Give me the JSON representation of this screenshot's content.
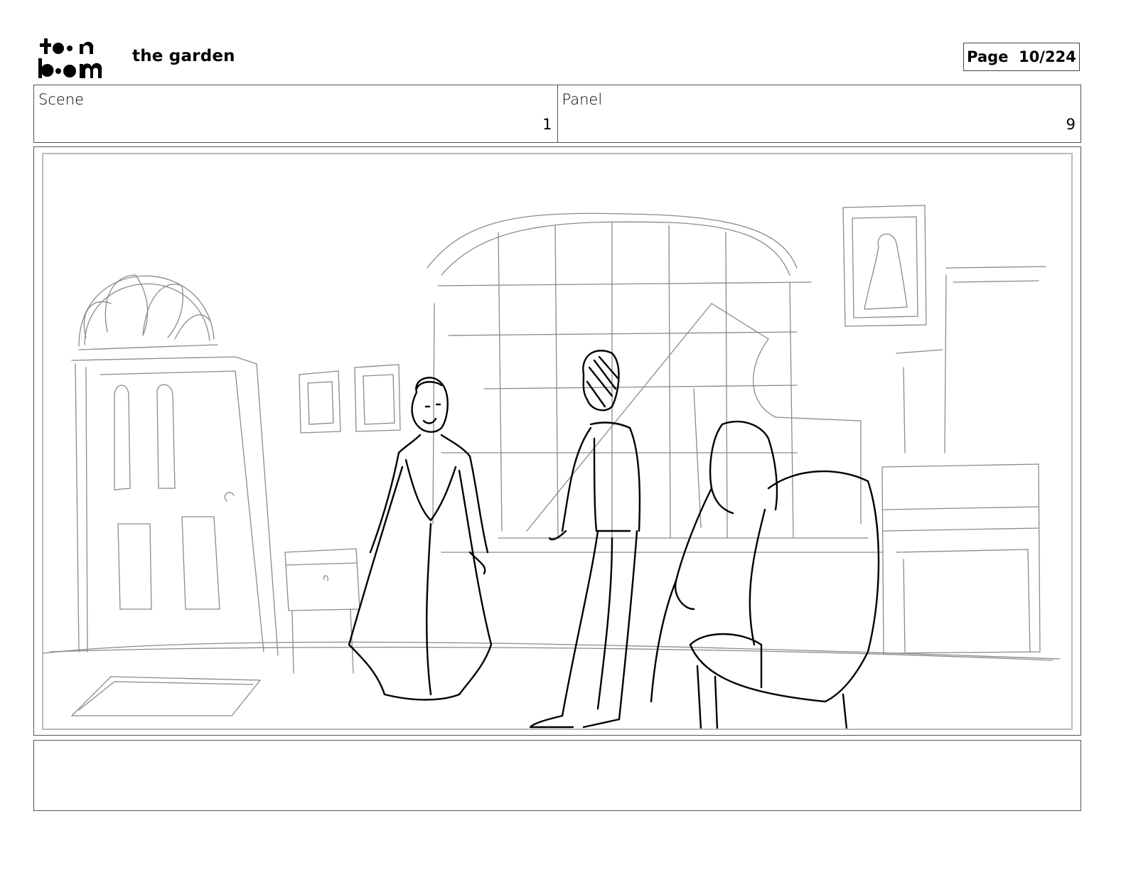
{
  "header": {
    "logo_text_top": "toon",
    "logo_text_bottom": "boom",
    "project_title": "the garden",
    "page_label": "Page",
    "page_number": "10/224"
  },
  "scene": {
    "label": "Scene",
    "value": "1"
  },
  "panel": {
    "label": "Panel",
    "value": "9"
  },
  "notes": {
    "text": ""
  },
  "colors": {
    "sketch_light": "#888888",
    "sketch_dark": "#000000",
    "frame_border": "#555555"
  }
}
